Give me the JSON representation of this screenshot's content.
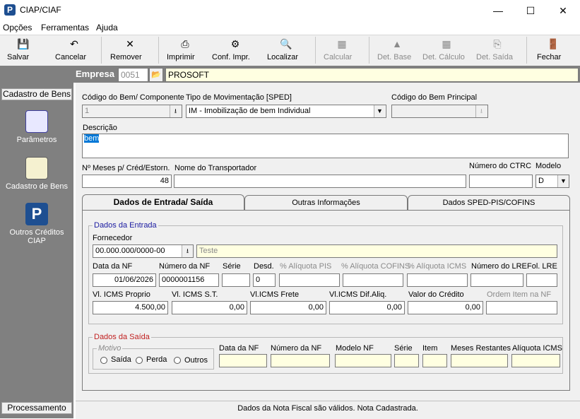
{
  "window": {
    "title": "CIAP/CIAF",
    "app_icon": "P"
  },
  "menu": [
    "Opções",
    "Ferramentas",
    "Ajuda"
  ],
  "toolbar": {
    "salvar": "Salvar",
    "cancelar": "Cancelar",
    "remover": "Remover",
    "imprimir": "Imprimir",
    "conf_impr": "Conf. Impr.",
    "localizar": "Localizar",
    "calcular": "Calcular",
    "det_base": "Det. Base",
    "det_calculo": "Det. Cálculo",
    "det_saida": "Det. Saída",
    "fechar": "Fechar"
  },
  "empresa": {
    "label": "Empresa",
    "code": "0051",
    "name": "PROSOFT"
  },
  "sidebar": {
    "header": "Cadastro de Bens",
    "items": [
      "Parâmetros",
      "Cadastro de Bens",
      "Outros Créditos CIAP"
    ],
    "footer": "Processamento"
  },
  "form": {
    "codigo_bem_label": "Código do Bem/ Componente",
    "codigo_bem_value": "1",
    "tipo_mov_label": "Tipo de Movimentação [SPED]",
    "tipo_mov_value": "IM - Imobilização de bem Individual",
    "codigo_principal_label": "Código do Bem Principal",
    "codigo_principal_value": "",
    "descricao_label": "Descrição",
    "descricao_value": "bem",
    "meses_label": "Nº Meses p/ Créd/Estorn.",
    "meses_value": "48",
    "transportador_label": "Nome do Transportador",
    "transportador_value": "",
    "ctrc_label": "Número do CTRC",
    "ctrc_value": "",
    "modelo_label": "Modelo",
    "modelo_value": "D"
  },
  "tabs": [
    "Dados de Entrada/ Saída",
    "Outras Informações",
    "Dados SPED-PIS/COFINS"
  ],
  "entrada": {
    "title": "Dados da Entrada",
    "fornecedor_label": "Fornecedor",
    "fornecedor_code": "00.000.000/0000-00",
    "fornecedor_name": "Teste",
    "data_nf_label": "Data da NF",
    "data_nf": "01/06/2026",
    "numero_nf_label": "Número da NF",
    "numero_nf": "0000001156",
    "serie_label": "Série",
    "serie": "",
    "desd_label": "Desd.",
    "desd": "0",
    "aliq_pis_label": "% Alíquota PIS",
    "aliq_pis": "",
    "aliq_cofins_label": "% Alíquota COFINS",
    "aliq_cofins": "",
    "aliq_icms_label": "% Alíquota ICMS",
    "aliq_icms": "",
    "numero_lre_label": "Número do LRE",
    "numero_lre": "",
    "fol_lre_label": "Fol. LRE",
    "fol_lre": "",
    "vl_icms_proprio_label": "Vl. ICMS Proprio",
    "vl_icms_proprio": "4.500,00",
    "vl_icms_st_label": "Vl. ICMS S.T.",
    "vl_icms_st": "0,00",
    "vl_icms_frete_label": "Vl.ICMS Frete",
    "vl_icms_frete": "0,00",
    "vl_icms_dif_label": "Vl.ICMS Dif.Aliq.",
    "vl_icms_dif": "0,00",
    "valor_credito_label": "Valor do Crédito",
    "valor_credito": "0,00",
    "ordem_item_label": "Ordem Item na NF",
    "ordem_item": ""
  },
  "saida": {
    "title": "Dados da Saída",
    "motivo_label": "Motivo",
    "motivo_options": [
      "Saída",
      "Perda",
      "Outros"
    ],
    "data_nf_label": "Data da NF",
    "numero_nf_label": "Número da NF",
    "modelo_nf_label": "Modelo NF",
    "serie_label": "Série",
    "item_label": "Item",
    "meses_restantes_label": "Meses Restantes",
    "aliquota_icms_label": "Alíquota ICMS"
  },
  "status": "Dados da Nota Fiscal são válidos. Nota Cadastrada."
}
